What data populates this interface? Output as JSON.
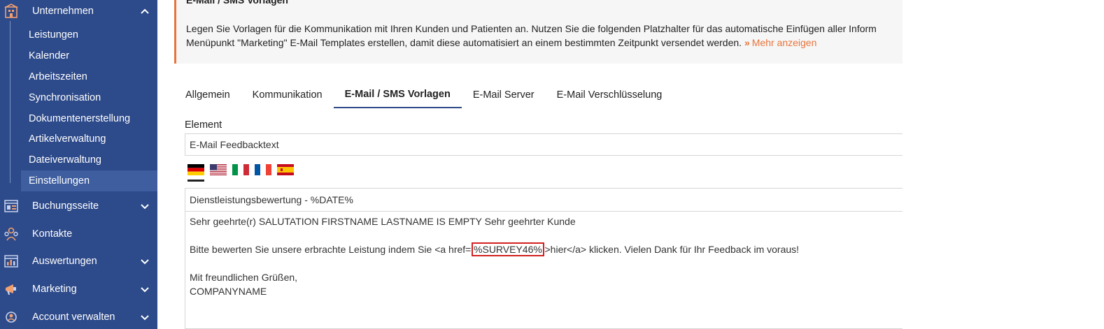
{
  "sidebar": {
    "sections": [
      {
        "label": "Unternehmen",
        "icon": "building-icon",
        "chevron": "up"
      },
      {
        "label": "Buchungsseite",
        "icon": "booking-page-icon",
        "chevron": "down"
      },
      {
        "label": "Kontakte",
        "icon": "contacts-icon",
        "chevron": ""
      },
      {
        "label": "Auswertungen",
        "icon": "reports-icon",
        "chevron": "down"
      },
      {
        "label": "Marketing",
        "icon": "marketing-icon",
        "chevron": "down"
      },
      {
        "label": "Account verwalten",
        "icon": "account-icon",
        "chevron": "down"
      }
    ],
    "sub_items": [
      {
        "label": "Leistungen"
      },
      {
        "label": "Kalender"
      },
      {
        "label": "Arbeitszeiten"
      },
      {
        "label": "Synchronisation"
      },
      {
        "label": "Dokumentenerstellung"
      },
      {
        "label": "Artikelverwaltung"
      },
      {
        "label": "Dateiverwaltung"
      },
      {
        "label": "Einstellungen",
        "active": true
      }
    ]
  },
  "info": {
    "title": "E-Mail / SMS Vorlagen",
    "line1": "Legen Sie Vorlagen für die Kommunikation mit Ihren Kunden und Patienten an. Nutzen Sie die folgenden Platzhalter für das automatische Einfügen aller Inform",
    "line2": "Menüpunkt \"Marketing\" E-Mail Templates erstellen, damit diese automatisiert an einem bestimmten Zeitpunkt versendet werden.",
    "more_link": "Mehr anzeigen",
    "more_icon": "double-chevron-down-icon"
  },
  "tabs": [
    {
      "label": "Allgemein"
    },
    {
      "label": "Kommunikation"
    },
    {
      "label": "E-Mail / SMS Vorlagen",
      "active": true
    },
    {
      "label": "E-Mail Server"
    },
    {
      "label": "E-Mail Verschlüsselung"
    }
  ],
  "element": {
    "label": "Element",
    "value": "E-Mail Feedbacktext"
  },
  "languages": [
    {
      "name": "german-flag-icon",
      "active": true
    },
    {
      "name": "us-flag-icon"
    },
    {
      "name": "italian-flag-icon"
    },
    {
      "name": "french-flag-icon"
    },
    {
      "name": "spanish-flag-icon"
    }
  ],
  "template": {
    "subject": "Dienstleistungsbewertung - %DATE%",
    "line1": "Sehr geehrte(r) SALUTATION FIRSTNAME LASTNAME IS EMPTY Sehr geehrter Kunde",
    "line2_pre": "Bitte bewerten Sie unsere erbrachte Leistung indem Sie <a href='",
    "line2_highlight": "%SURVEY46%",
    "line2_post": "'>hier</a> klicken. Vielen Dank für Ihr Feedback im voraus!",
    "line3": "Mit freundlichen Grüßen,",
    "line4": "COMPANYNAME"
  },
  "colors": {
    "sidebar_bg": "#2d4a8a",
    "accent": "#e8743b",
    "highlight_border": "#d32020"
  }
}
